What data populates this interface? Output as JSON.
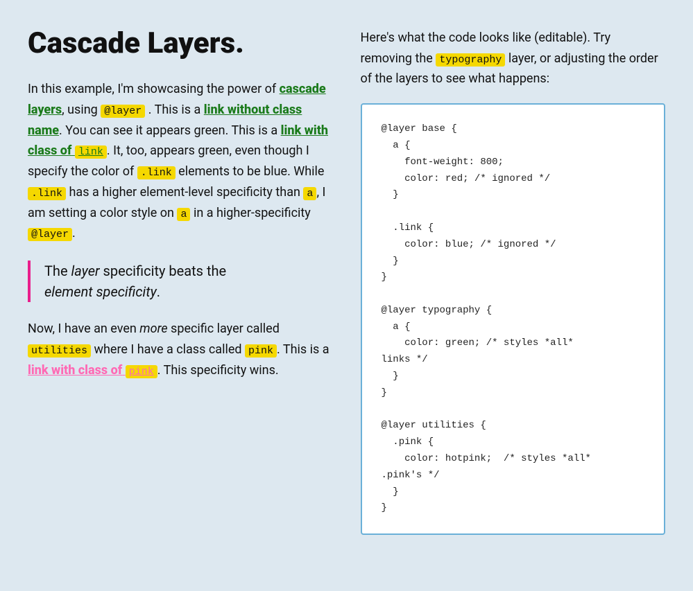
{
  "page": {
    "background": "#dde8f0"
  },
  "left": {
    "heading": "Cascade Layers.",
    "para1_plain1": "In this example, I'm showcasing the power of",
    "para1_link1_text": "cascade layers",
    "para1_plain2": ", using",
    "para1_code1": "@layer",
    "para1_plain3": ". This is a",
    "para1_link2_text": "link without class name",
    "para1_plain4": ". You can see it appears green. This is a",
    "para1_link3_text": "link with class of",
    "para1_code2": "link",
    "para1_plain5": ". It, too, appears green, even though I specify the color of",
    "para1_code3": ".link",
    "para1_plain6": "elements to be blue. While",
    "para1_code4": ".link",
    "para1_plain7": "has a higher element-level specificity than",
    "para1_code5": "a",
    "para1_plain8": ", I am setting a color style on",
    "para1_code6": "a",
    "para1_plain9": "in a higher-specificity",
    "para1_code7": "@layer",
    "para1_plain10": ".",
    "blockquote1": "The",
    "blockquote_em1": "layer",
    "blockquote2": "specificity beats the",
    "blockquote_em2": "element specificity",
    "blockquote3": ".",
    "para2_plain1": "Now, I have an even",
    "para2_em1": "more",
    "para2_plain2": "specific layer called",
    "para2_code1": "utilities",
    "para2_plain3": "where I have a class called",
    "para2_code2": "pink",
    "para2_plain4": ". This is a",
    "para2_link1_text": "link with class of",
    "para2_code3": "pink",
    "para2_plain5": ". This specificity wins."
  },
  "right": {
    "intro1": "Here's what the code looks like (editable). Try removing the",
    "intro_highlight": "typography",
    "intro2": "layer, or adjusting the order of the layers to see what happens:",
    "code": "@layer base {\n  a {\n    font-weight: 800;\n    color: red; /* ignored */\n  }\n\n  .link {\n    color: blue; /* ignored */\n  }\n}\n\n@layer typography {\n  a {\n    color: green; /* styles *all*\nlinks */\n  }\n}\n\n@layer utilities {\n  .pink {\n    color: hotpink;  /* styles *all*\n.pink's */\n  }\n}"
  }
}
